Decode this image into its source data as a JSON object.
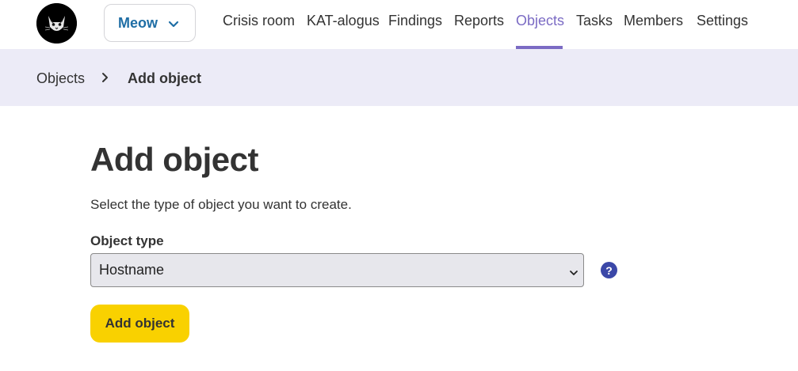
{
  "header": {
    "logo_name": "cat-logo",
    "organization": {
      "label": "Meow",
      "icon": "chevron-down-icon"
    },
    "nav": [
      {
        "id": "crisis-room",
        "label": "Crisis room",
        "active": false
      },
      {
        "id": "katalogus",
        "label": "KAT-alogus",
        "active": false
      },
      {
        "id": "findings",
        "label": "Findings",
        "active": false
      },
      {
        "id": "reports",
        "label": "Reports",
        "active": false
      },
      {
        "id": "objects",
        "label": "Objects",
        "active": true
      },
      {
        "id": "tasks",
        "label": "Tasks",
        "active": false
      },
      {
        "id": "members",
        "label": "Members",
        "active": false
      },
      {
        "id": "settings",
        "label": "Settings",
        "active": false
      }
    ]
  },
  "breadcrumb": {
    "items": [
      "Objects",
      "Add object"
    ],
    "separator_icon": "chevron-right-icon"
  },
  "main": {
    "title": "Add object",
    "intro": "Select the type of object you want to create.",
    "object_type": {
      "label": "Object type",
      "selected": "Hostname",
      "help_glyph": "?"
    },
    "submit_label": "Add object"
  },
  "colors": {
    "accent": "#7b6bc4",
    "breadcrumb_bg": "#ecebf7",
    "org_text": "#1f6ea5",
    "button_bg": "#f9d100",
    "help_bg": "#3b48a8"
  }
}
